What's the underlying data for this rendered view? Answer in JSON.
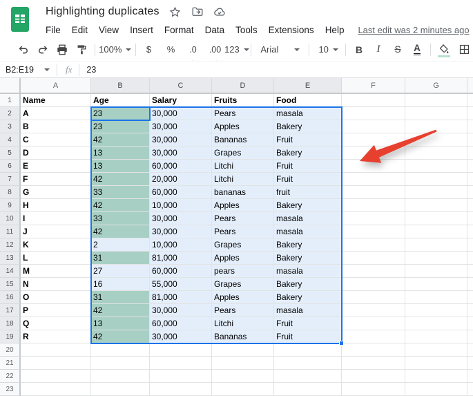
{
  "app": {
    "title": "Highlighting duplicates",
    "menu": [
      "File",
      "Edit",
      "View",
      "Insert",
      "Format",
      "Data",
      "Tools",
      "Extensions",
      "Help"
    ],
    "last_edit": "Last edit was 2 minutes ago"
  },
  "toolbar": {
    "zoom": "100%",
    "currency": "$",
    "percent": "%",
    "decrease_decimal": ".0",
    "increase_decimal": ".00",
    "more_formats": "123",
    "font_family": "Arial",
    "font_size": "10",
    "bold": "B",
    "italic": "I",
    "strikethrough": "S",
    "text_color": "A"
  },
  "formula_bar": {
    "name_box": "B2:E19",
    "fx_label": "fx",
    "value": "23"
  },
  "grid": {
    "column_headers": [
      "A",
      "B",
      "C",
      "D",
      "E",
      "F",
      "G"
    ],
    "selected_columns": [
      "B",
      "C",
      "D",
      "E"
    ],
    "selected_rows_from": 2,
    "selected_rows_to": 19,
    "visible_row_count": 23,
    "header_row": {
      "name": "Name",
      "age": "Age",
      "salary": "Salary",
      "fruits": "Fruits",
      "food": "Food"
    },
    "rows": [
      {
        "row": 2,
        "name": "A",
        "age": "23",
        "salary": "30,000",
        "fruits": "Pears",
        "food": "masala",
        "duplicate": true
      },
      {
        "row": 3,
        "name": "B",
        "age": "23",
        "salary": "30,000",
        "fruits": "Apples",
        "food": "Bakery",
        "duplicate": true
      },
      {
        "row": 4,
        "name": "C",
        "age": "42",
        "salary": "30,000",
        "fruits": "Bananas",
        "food": "Fruit",
        "duplicate": true
      },
      {
        "row": 5,
        "name": "D",
        "age": "13",
        "salary": "30,000",
        "fruits": "Grapes",
        "food": "Bakery",
        "duplicate": true
      },
      {
        "row": 6,
        "name": "E",
        "age": "13",
        "salary": "60,000",
        "fruits": "Litchi",
        "food": "Fruit",
        "duplicate": true
      },
      {
        "row": 7,
        "name": "F",
        "age": "42",
        "salary": "20,000",
        "fruits": "Litchi",
        "food": "Fruit",
        "duplicate": true
      },
      {
        "row": 8,
        "name": "G",
        "age": "33",
        "salary": "60,000",
        "fruits": "bananas",
        "food": "fruit",
        "duplicate": true
      },
      {
        "row": 9,
        "name": "H",
        "age": "42",
        "salary": "10,000",
        "fruits": "Apples",
        "food": "Bakery",
        "duplicate": true
      },
      {
        "row": 10,
        "name": "I",
        "age": "33",
        "salary": "30,000",
        "fruits": "Pears",
        "food": "masala",
        "duplicate": true
      },
      {
        "row": 11,
        "name": "J",
        "age": "42",
        "salary": "30,000",
        "fruits": "Pears",
        "food": "masala",
        "duplicate": true
      },
      {
        "row": 12,
        "name": "K",
        "age": "2",
        "salary": "10,000",
        "fruits": "Grapes",
        "food": "Bakery",
        "duplicate": false
      },
      {
        "row": 13,
        "name": "L",
        "age": "31",
        "salary": "81,000",
        "fruits": "Apples",
        "food": "Bakery",
        "duplicate": true
      },
      {
        "row": 14,
        "name": "M",
        "age": "27",
        "salary": "60,000",
        "fruits": "pears",
        "food": "masala",
        "duplicate": false
      },
      {
        "row": 15,
        "name": "N",
        "age": "16",
        "salary": "55,000",
        "fruits": "Grapes",
        "food": "Bakery",
        "duplicate": false
      },
      {
        "row": 16,
        "name": "O",
        "age": "31",
        "salary": "81,000",
        "fruits": "Apples",
        "food": "Bakery",
        "duplicate": true
      },
      {
        "row": 17,
        "name": "P",
        "age": "42",
        "salary": "30,000",
        "fruits": "Pears",
        "food": "masala",
        "duplicate": true
      },
      {
        "row": 18,
        "name": "Q",
        "age": "13",
        "salary": "60,000",
        "fruits": "Litchi",
        "food": "Fruit",
        "duplicate": true
      },
      {
        "row": 19,
        "name": "R",
        "age": "42",
        "salary": "30,000",
        "fruits": "Bananas",
        "food": "Fruit",
        "duplicate": true
      }
    ]
  },
  "selection": {
    "range": "B2:E19",
    "active_cell": "B2"
  },
  "colors": {
    "accent_blue": "#1a73e8",
    "duplicate_highlight": "#a7cfc3",
    "selection_tint": "#e4eefb",
    "arrow_red": "#e8402f",
    "sheets_green": "#23a566"
  }
}
